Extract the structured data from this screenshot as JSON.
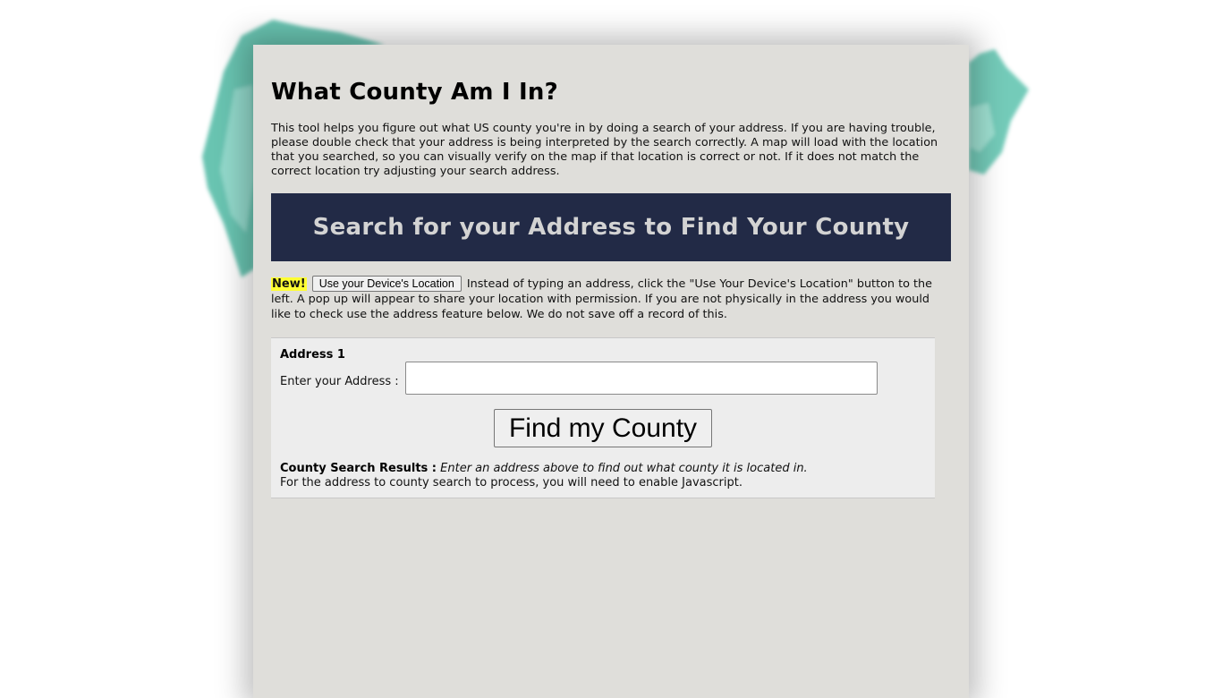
{
  "page": {
    "title": "What County Am I In?",
    "intro": "This tool helps you figure out what US county you're in by doing a search of your address. If you are having trouble, please double check that your address is being interpreted by the search correctly. A map will load with the location that you searched, so you can visually verify on the map if that location is correct or not. If it does not match the correct location try adjusting your search address."
  },
  "banner": {
    "text": "Search for your Address to Find Your County"
  },
  "device": {
    "new_badge": "New!",
    "button_label": "Use your Device's Location",
    "description": "Instead of typing an address, click the \"Use Your Device's Location\" button to the left. A pop up will appear to share your location with permission. If you are not physically in the address you would like to check use the address feature below. We do not save off a record of this."
  },
  "form": {
    "heading": "Address 1",
    "address_label": "Enter your Address :",
    "address_value": "",
    "submit_label": "Find my County",
    "results_label": "County Search Results :",
    "results_value": "Enter an address above to find out what county it is located in.",
    "javascript_note": "For the address to county search to process, you will need to enable Javascript."
  },
  "colors": {
    "page_bg": "#dfdeda",
    "banner_bg": "#222a46",
    "banner_text": "#d3d3d3",
    "map_accent": "#5cc2ad",
    "new_highlight": "#ffff33"
  }
}
